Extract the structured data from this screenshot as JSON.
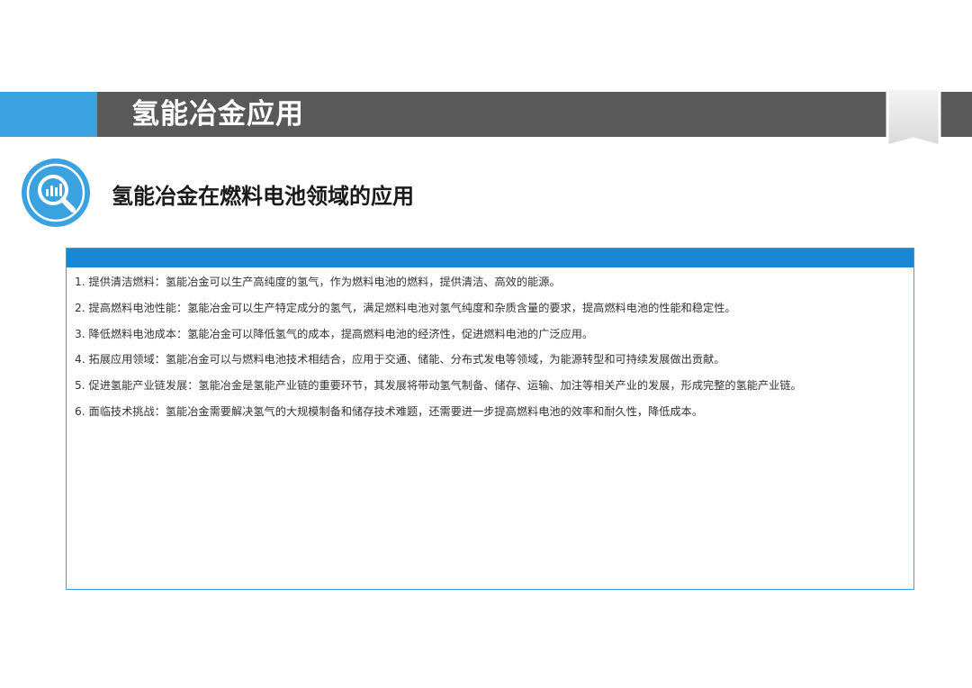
{
  "header": {
    "title": "氢能冶金应用",
    "accent_color": "#3aa3df",
    "band_color": "#595959"
  },
  "section": {
    "icon": "magnifier-chart-icon",
    "title": "氢能冶金在燃料电池领域的应用"
  },
  "content": {
    "header_color": "#1a87d4",
    "items": [
      "1. 提供清洁燃料：氢能冶金可以生产高纯度的氢气，作为燃料电池的燃料，提供清洁、高效的能源。",
      "2. 提高燃料电池性能：氢能冶金可以生产特定成分的氢气，满足燃料电池对氢气纯度和杂质含量的要求，提高燃料电池的性能和稳定性。",
      "3. 降低燃料电池成本：氢能冶金可以降低氢气的成本，提高燃料电池的经济性，促进燃料电池的广泛应用。",
      "4. 拓展应用领域：氢能冶金可以与燃料电池技术相结合，应用于交通、储能、分布式发电等领域，为能源转型和可持续发展做出贡献。",
      "5. 促进氢能产业链发展：氢能冶金是氢能产业链的重要环节，其发展将带动氢气制备、储存、运输、加注等相关产业的发展，形成完整的氢能产业链。",
      "6. 面临技术挑战：氢能冶金需要解决氢气的大规模制备和储存技术难题，还需要进一步提高燃料电池的效率和耐久性，降低成本。"
    ]
  }
}
